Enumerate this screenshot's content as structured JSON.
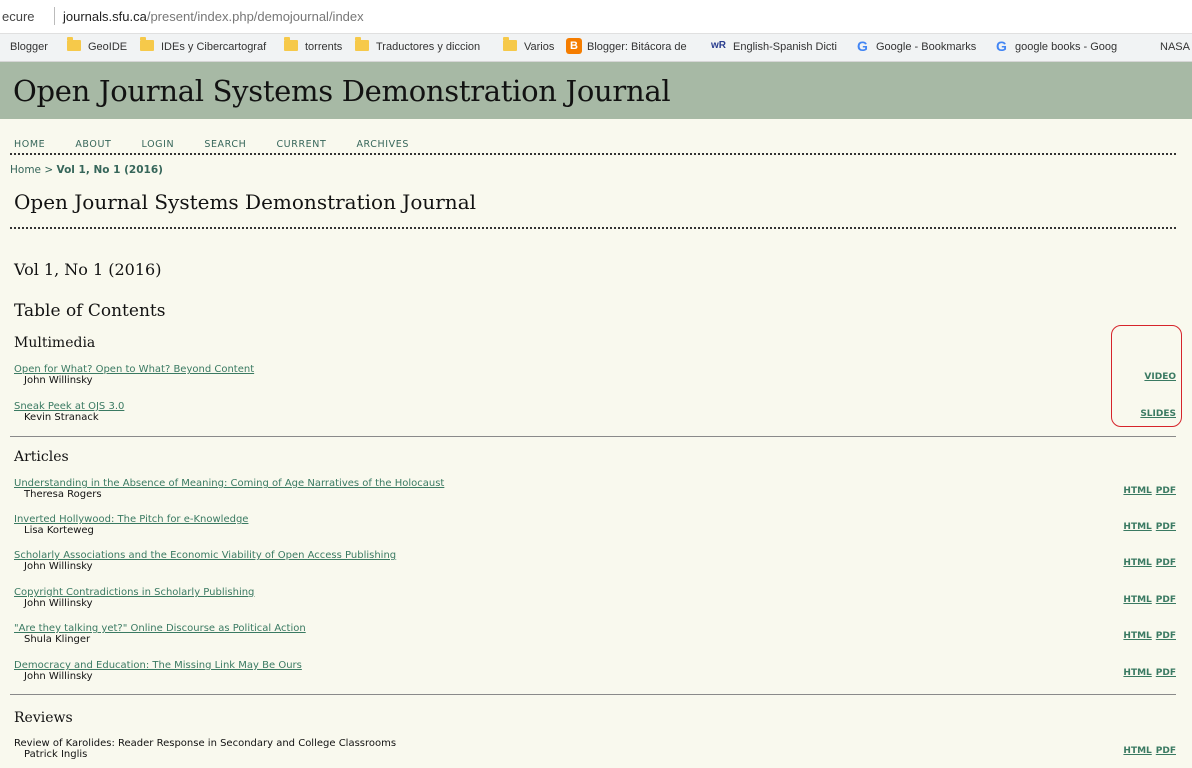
{
  "browser": {
    "security_label": "ecure",
    "url_host": "journals.sfu.ca",
    "url_path": "/present/index.php/demojournal/index"
  },
  "bookmarks": [
    {
      "label": "Blogger",
      "icon": "none"
    },
    {
      "label": "GeoIDE",
      "icon": "folder-icon"
    },
    {
      "label": "IDEs y Cibercartograf",
      "icon": "folder-icon"
    },
    {
      "label": "torrents",
      "icon": "folder-icon"
    },
    {
      "label": "Traductores y diccion",
      "icon": "folder-icon"
    },
    {
      "label": "Varios",
      "icon": "folder-icon"
    },
    {
      "label": "Blogger: Bitácora de",
      "icon": "blogger-icon"
    },
    {
      "label": "English-Spanish Dicti",
      "icon": "wordreference-icon"
    },
    {
      "label": "Google - Bookmarks",
      "icon": "google-icon"
    },
    {
      "label": "google books - Goog",
      "icon": "google-icon"
    },
    {
      "label": "NASA",
      "icon": "none"
    }
  ],
  "site": {
    "header_title": "Open Journal Systems Demonstration Journal",
    "nav": [
      "HOME",
      "ABOUT",
      "LOGIN",
      "SEARCH",
      "CURRENT",
      "ARCHIVES"
    ],
    "breadcrumb_home": "Home",
    "breadcrumb_sep": ">",
    "breadcrumb_current": "Vol 1, No 1 (2016)",
    "page_title": "Open Journal Systems Demonstration Journal",
    "issue_title": "Vol 1, No 1 (2016)",
    "toc_title": "Table of Contents"
  },
  "sections": [
    {
      "title": "Multimedia",
      "entries": [
        {
          "title": "Open for What? Open to What? Beyond Content",
          "author": "John Willinsky",
          "links": [
            "VIDEO"
          ],
          "linked": true
        },
        {
          "title": "Sneak Peek at OJS 3.0",
          "author": "Kevin Stranack",
          "links": [
            "SLIDES"
          ],
          "linked": true
        }
      ]
    },
    {
      "title": "Articles",
      "entries": [
        {
          "title": "Understanding in the Absence of Meaning: Coming of Age Narratives of the Holocaust",
          "author": "Theresa Rogers",
          "links": [
            "HTML",
            "PDF"
          ],
          "linked": true
        },
        {
          "title": "Inverted Hollywood: The Pitch for e-Knowledge",
          "author": "Lisa Korteweg",
          "links": [
            "HTML",
            "PDF"
          ],
          "linked": true
        },
        {
          "title": "Scholarly Associations and the Economic Viability of Open Access Publishing",
          "author": "John Willinsky",
          "links": [
            "HTML",
            "PDF"
          ],
          "linked": true
        },
        {
          "title": "Copyright Contradictions in Scholarly Publishing",
          "author": "John Willinsky",
          "links": [
            "HTML",
            "PDF"
          ],
          "linked": true
        },
        {
          "title": "\"Are they talking yet?\" Online Discourse as Political Action",
          "author": "Shula Klinger",
          "links": [
            "HTML",
            "PDF"
          ],
          "linked": true
        },
        {
          "title": "Democracy and Education: The Missing Link May Be Ours",
          "author": "John Willinsky",
          "links": [
            "HTML",
            "PDF"
          ],
          "linked": true
        }
      ]
    },
    {
      "title": "Reviews",
      "entries": [
        {
          "title": "Review of Karolides: Reader Response in Secondary and College Classrooms",
          "author": "Patrick Inglis",
          "links": [
            "HTML",
            "PDF"
          ],
          "linked": false
        }
      ]
    }
  ],
  "colors": {
    "header_bg": "#a7b9a5",
    "page_bg": "#f9f9ee",
    "link": "#3a7a62",
    "highlight": "#d6242b"
  }
}
